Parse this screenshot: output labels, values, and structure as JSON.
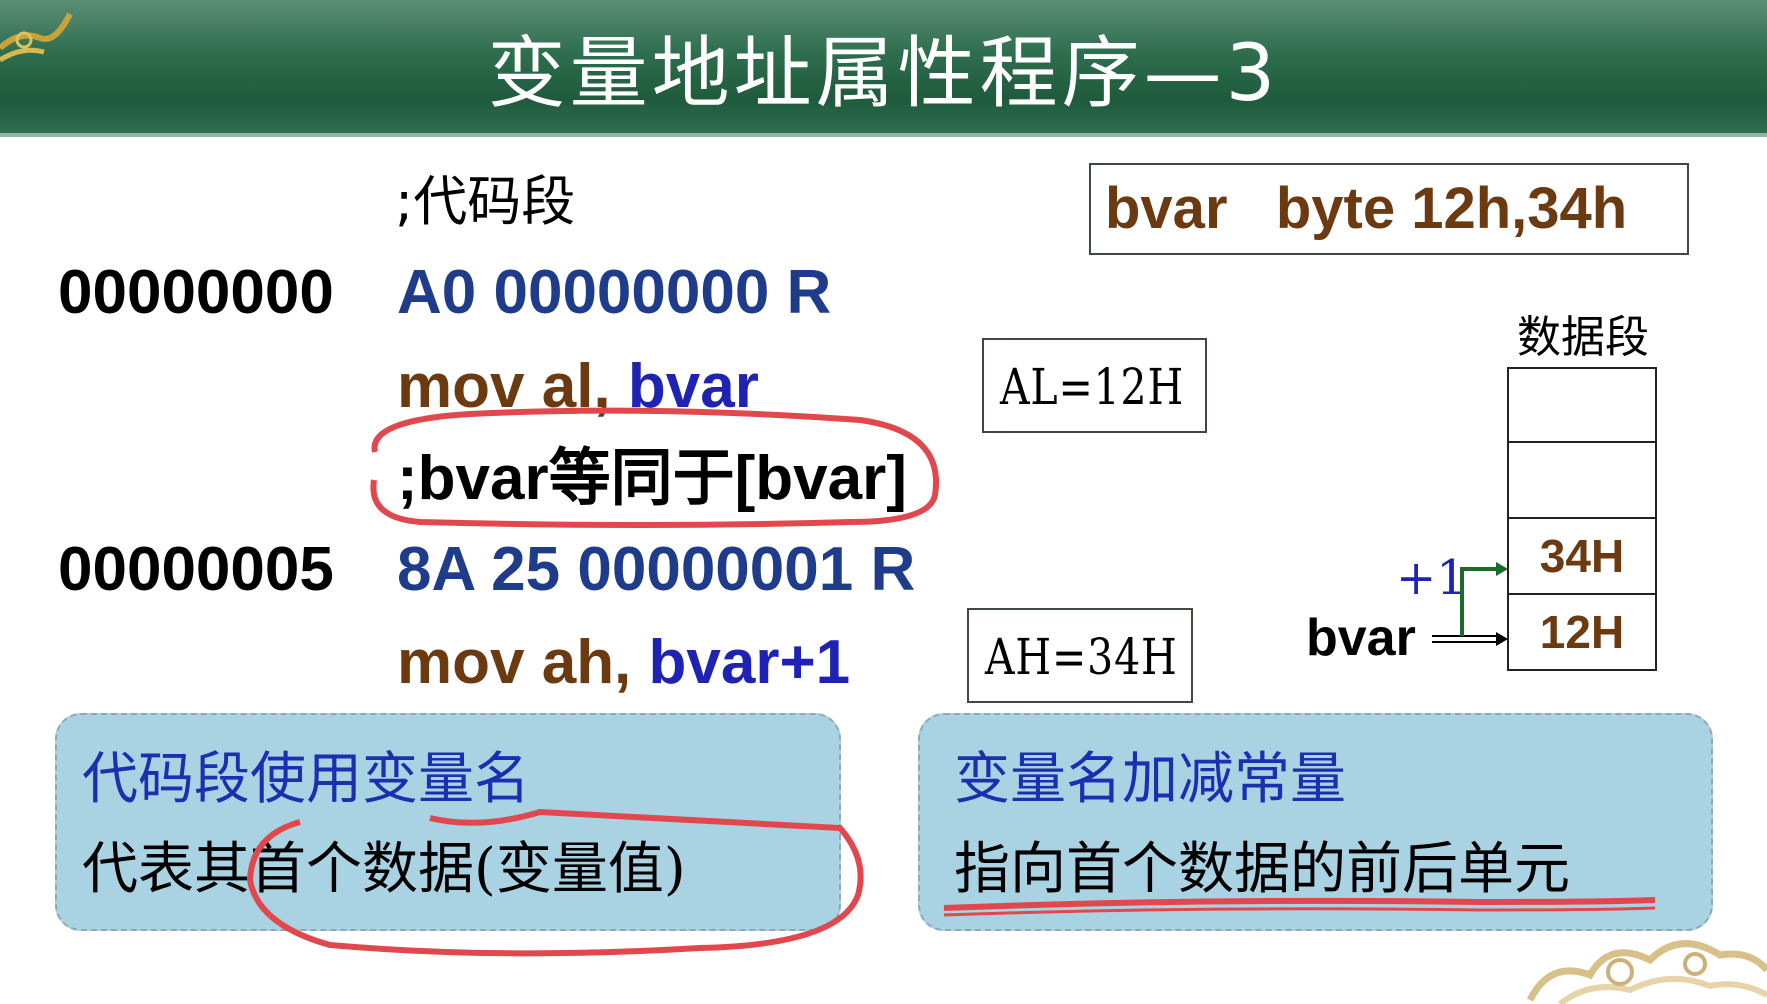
{
  "slide": {
    "title": "变量地址属性程序—3",
    "code_comment": ";代码段",
    "lines": [
      {
        "addr": "00000000",
        "machine": "A0 00000000 R"
      },
      {
        "asm_op": "mov al, ",
        "asm_var": "bvar"
      },
      {
        "comment": ";bvar等同于[bvar]"
      },
      {
        "addr": "00000005",
        "machine": "8A 25 00000001 R"
      },
      {
        "asm_op": "mov ah, ",
        "asm_var": "bvar+1"
      }
    ],
    "al_value": "AL=12H",
    "ah_value": "AH=34H",
    "declaration": "bvar   byte 12h,34h",
    "memory": {
      "label": "数据段",
      "cells": [
        "",
        "",
        "34H",
        "12H"
      ],
      "pointer_label": "bvar",
      "offset_label": "+1"
    },
    "left_panel": {
      "line1": "代码段使用变量名",
      "line2": "代表其首个数据(变量值)"
    },
    "right_panel": {
      "line1": "变量名加减常量",
      "line2": "指向首个数据的前后单元"
    }
  },
  "colors": {
    "title_bar": "#2e6e4e",
    "code_navy": "#1f3c8a",
    "code_brown": "#6b3a10",
    "code_blue": "#1e23b4",
    "panel_bg": "#a9d3e3",
    "annotation_red": "#e0484e",
    "arrow_green": "#1c6b2a"
  }
}
